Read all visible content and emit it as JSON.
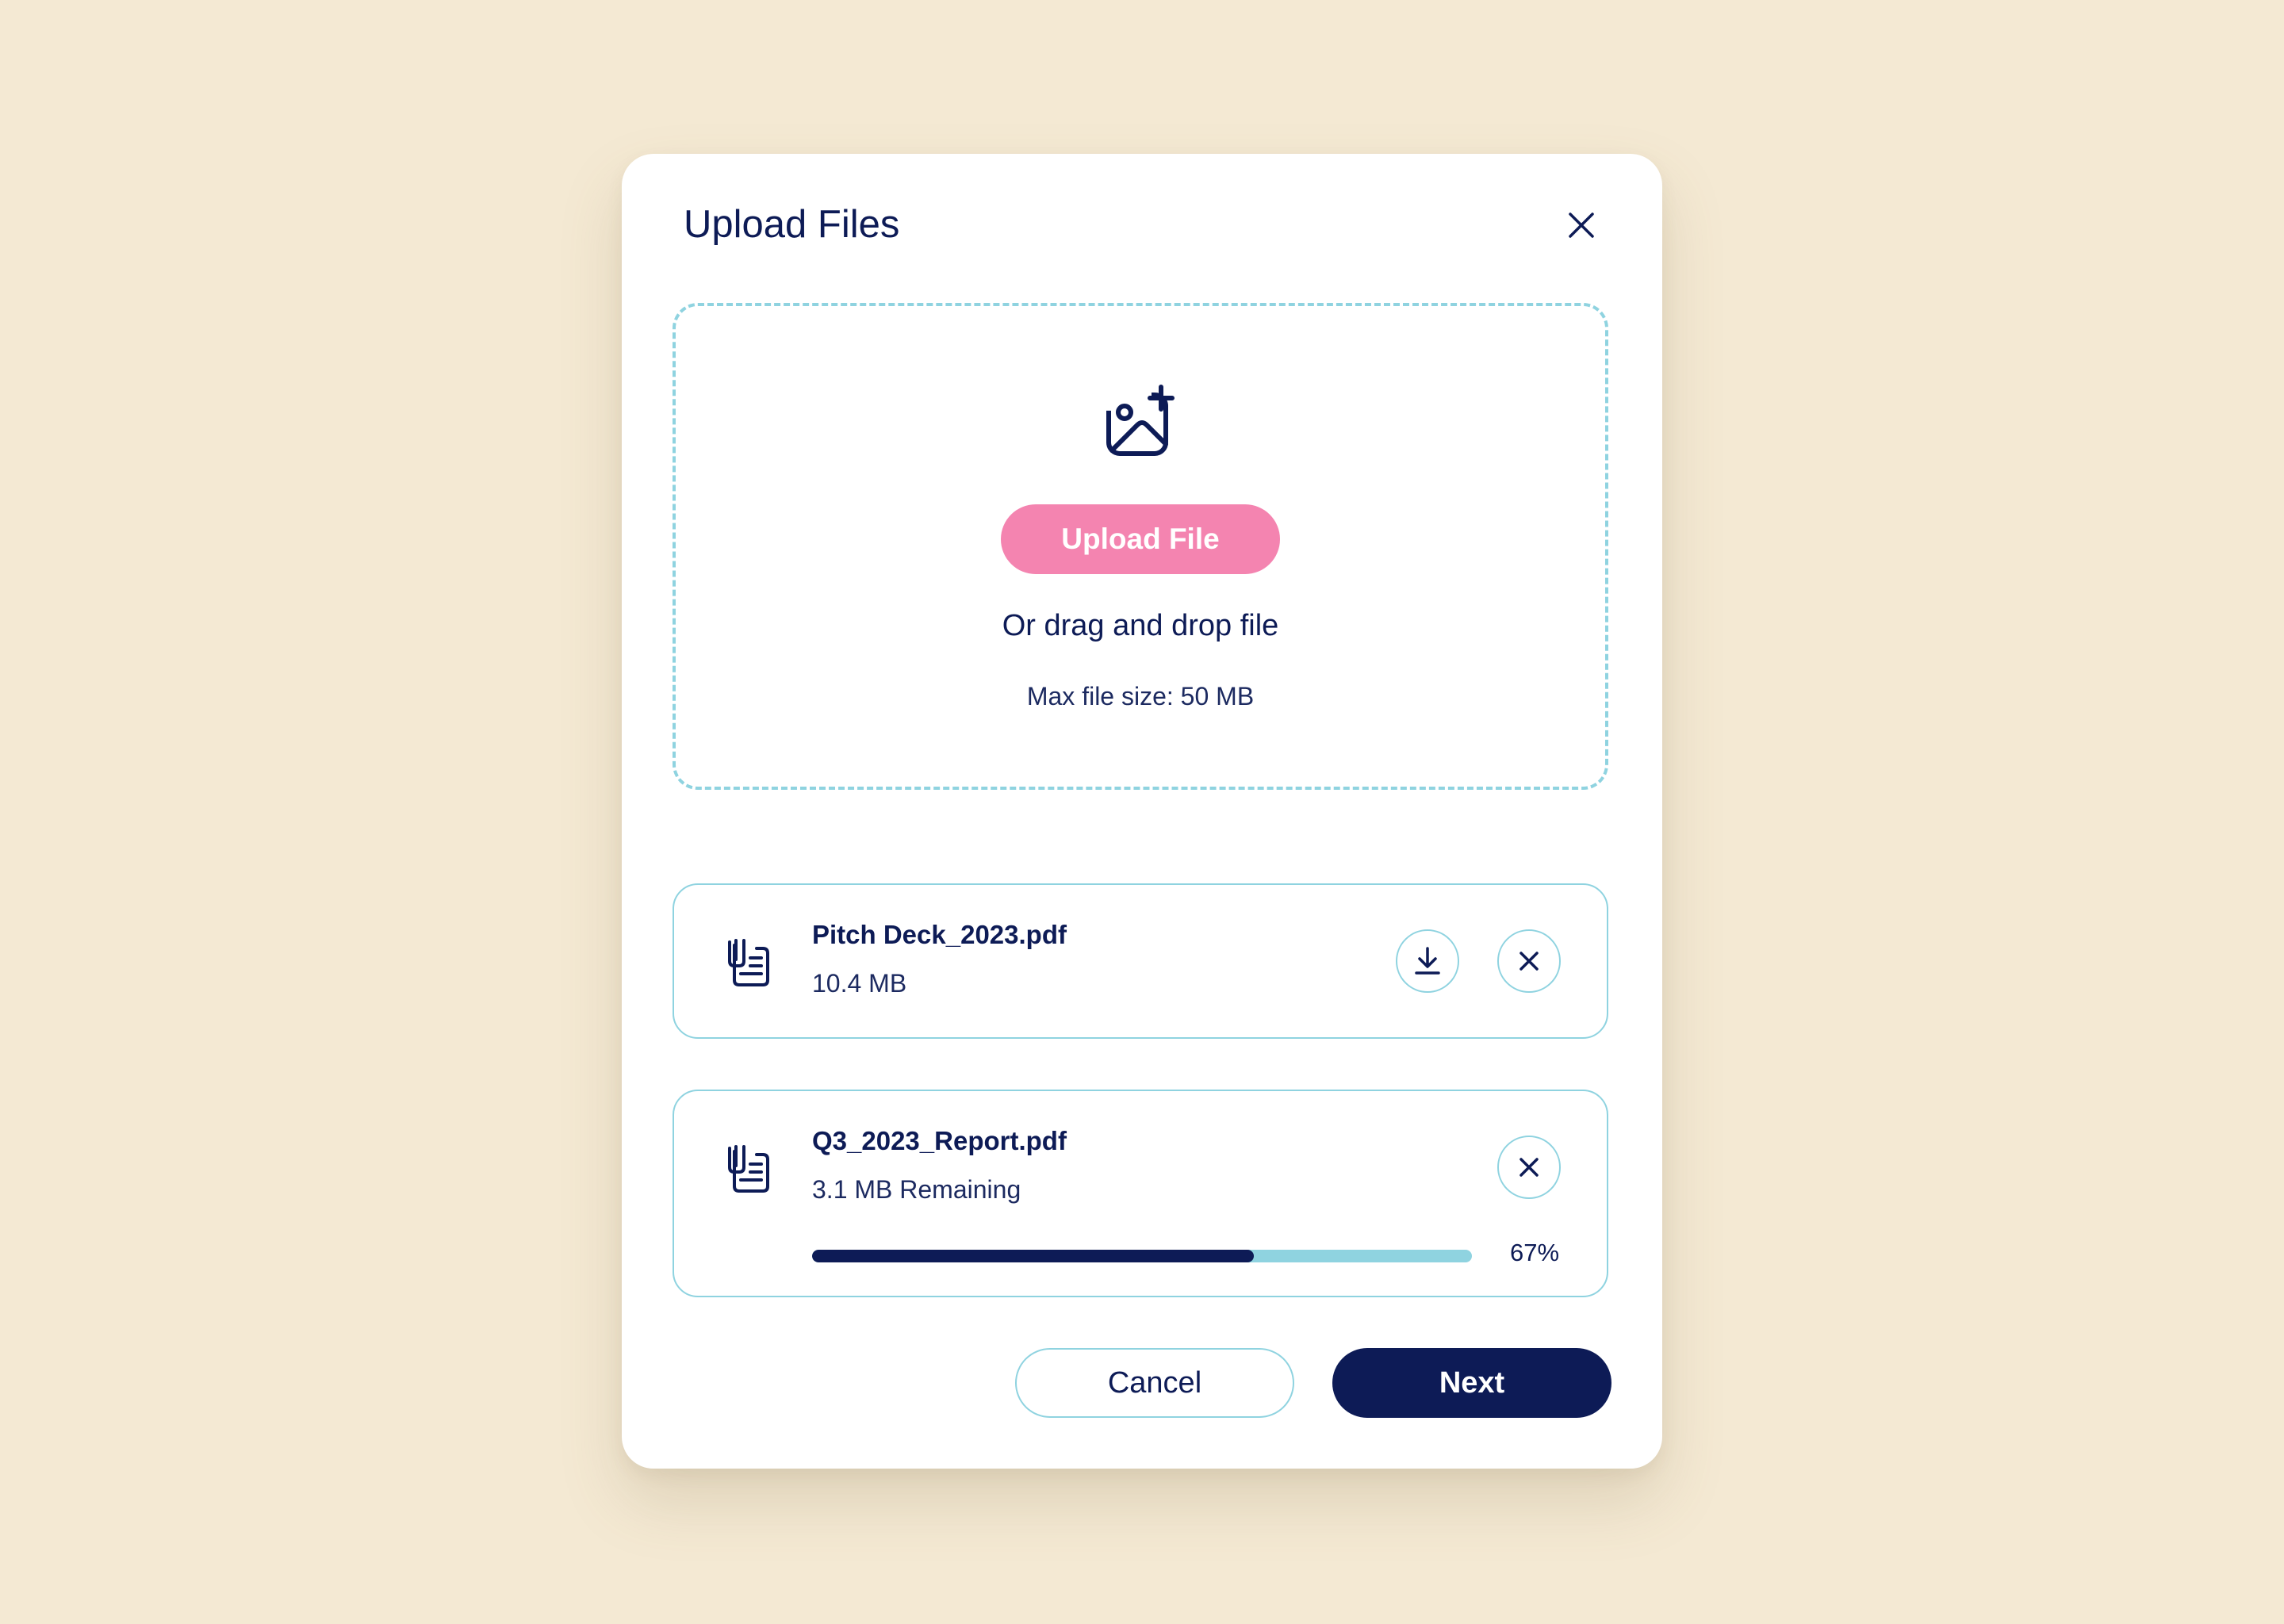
{
  "modal": {
    "title": "Upload Files",
    "close_icon": "close-icon"
  },
  "dropzone": {
    "icon": "add-image-icon",
    "upload_label": "Upload File",
    "drag_text": "Or drag and drop file",
    "max_size": "Max file size: 50 MB"
  },
  "files": [
    {
      "name": "Pitch Deck_2023.pdf",
      "meta": "10.4 MB",
      "icon": "file-document-icon",
      "actions": [
        "download-icon",
        "close-icon"
      ]
    },
    {
      "name": "Q3_2023_Report.pdf",
      "meta": "3.1 MB Remaining",
      "icon": "file-document-icon",
      "actions": [
        "close-icon"
      ],
      "progress": 0.67,
      "progress_label": "67%"
    }
  ],
  "footer": {
    "cancel_label": "Cancel",
    "next_label": "Next"
  },
  "colors": {
    "background": "#f4e9d3",
    "navy": "#0d1b56",
    "pink": "#f484b0",
    "light_blue": "#8fd3e0"
  }
}
